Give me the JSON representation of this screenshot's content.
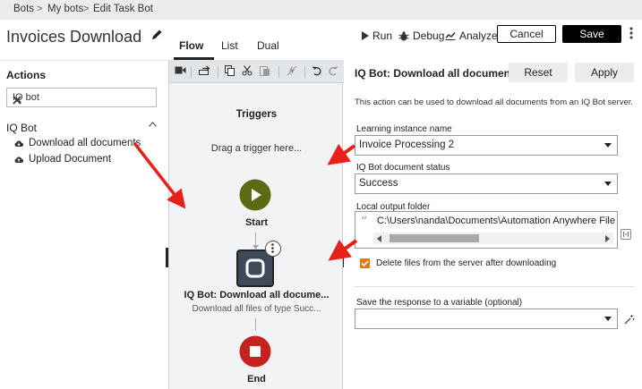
{
  "breadcrumb": [
    "Bots",
    "My bots",
    "Edit Task Bot"
  ],
  "breadcrumb_separator": ">",
  "header": {
    "title": "Invoices Download",
    "tabs": [
      {
        "label": "Flow",
        "active": true
      },
      {
        "label": "List",
        "active": false
      },
      {
        "label": "Dual",
        "active": false
      }
    ],
    "run_label": "Run",
    "debug_label": "Debug",
    "analyze_label": "Analyze",
    "cancel_label": "Cancel",
    "save_label": "Save"
  },
  "left_panel": {
    "title": "Actions",
    "search_value": "IQ bot",
    "group": "IQ Bot",
    "items": [
      "Download all documents",
      "Upload Document"
    ]
  },
  "flow": {
    "triggers_title": "Triggers",
    "triggers_hint": "Drag a trigger here...",
    "start_label": "Start",
    "action_node_label": "IQ Bot: Download all docume...",
    "action_node_sub": "Download all files of type Succ...",
    "end_label": "End"
  },
  "right_panel": {
    "title": "IQ Bot: Download all documents",
    "reset_label": "Reset",
    "apply_label": "Apply",
    "description": "This action can be used to download all documents from an IQ Bot server.",
    "learning_instance_label": "Learning instance name",
    "learning_instance_value": "Invoice Processing 2",
    "status_label": "IQ Bot document status",
    "status_value": "Success",
    "output_folder_label": "Local output folder",
    "output_folder_value": "C:\\Users\\nanda\\Documents\\Automation Anywhere File",
    "delete_checkbox_label": "Delete files from the server after downloading",
    "delete_checked": true,
    "save_response_label": "Save the response to a variable (optional)",
    "save_response_value": ""
  },
  "colors": {
    "start_node": "#5c6a12",
    "end_node": "#c5231d",
    "action_node": "#3c4a5a",
    "checkbox": "#e07a17",
    "annotation_arrow": "#e8201a"
  }
}
